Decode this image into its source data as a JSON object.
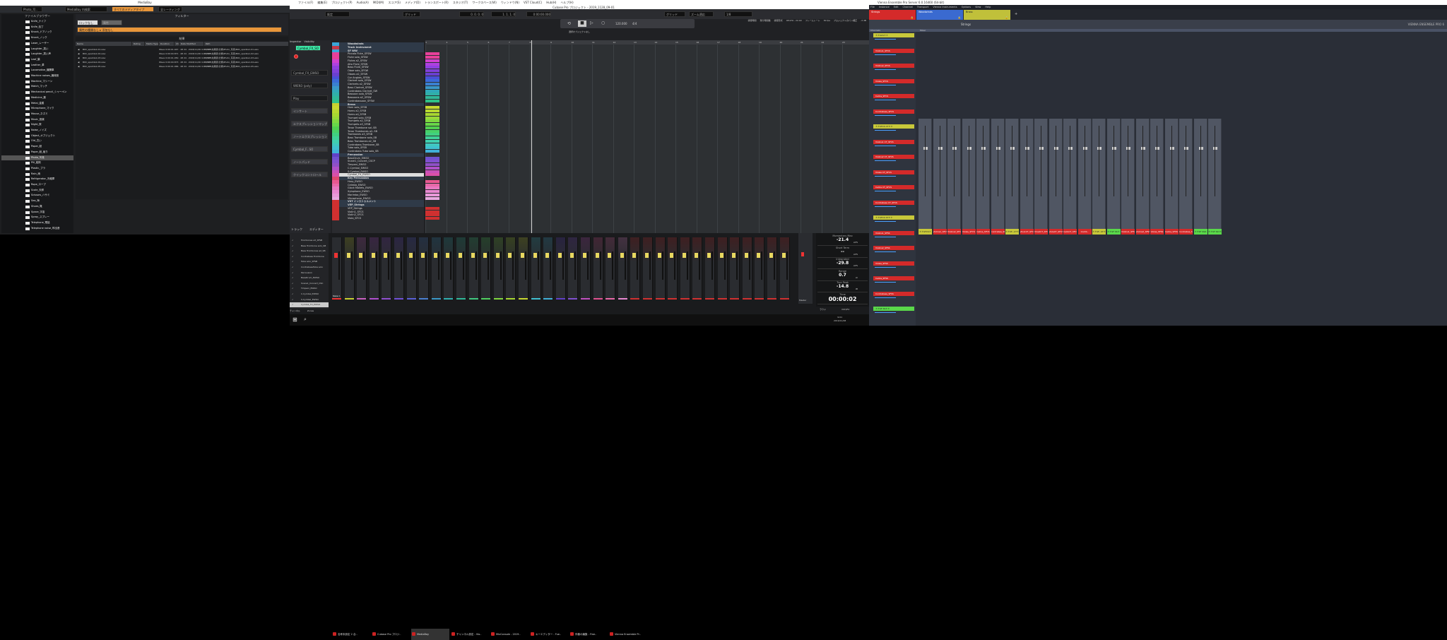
{
  "mediabay": {
    "title": "MediaBay",
    "path": "Photo_写..",
    "search_placeholder": "MediaBay 内検索",
    "media_type": "すべてのメディアタイプ",
    "rating": "全レーティング",
    "browser_header": "ファイルブラウザー",
    "filter_header": "フィルター",
    "filter_btn1": "ロックなし",
    "filter_btn2": "属性",
    "filter_tag1": "属性の種類なし",
    "filter_tag2": "添加なし",
    "results_header": "結果",
    "columns": [
      "Name",
      "Rating",
      "Media Type",
      "Duration",
      "Ch",
      "Date Modified",
      "Path"
    ],
    "results": [
      {
        "name": "B0C_sparkle1-01.wav",
        "info": "Wave 0:00:01.047 · 48 24 · 2018/11/26 11:17:07",
        "path": "E:\\SFX\\効果音\\分類\\Photo_写真\\B0C_sparkle1-01.wav"
      },
      {
        "name": "B0C_sparkle1-02.wav",
        "info": "Wave 0:00:00.871 · 48 24 · 2018/11/26 11:17:07",
        "path": "E:\\SFX\\効果音\\分類\\Photo_写真\\B0C_sparkle1-02.wav"
      },
      {
        "name": "B0C_sparkle1-03.wav",
        "info": "Wave 0:00:01.050 · 48 24 · 2018/11/26 11:17:07",
        "path": "E:\\SFX\\効果音\\分類\\Photo_写真\\B0C_sparkle1-03.wav"
      },
      {
        "name": "B0C_sparkle1-04.wav",
        "info": "Wave 0:00:00.873 · 48 24 · 2018/11/26 11:17:07",
        "path": "E:\\SFX\\効果音\\分類\\Photo_写真\\B0C_sparkle1-04.wav"
      },
      {
        "name": "B0C_sparkle1-05.wav",
        "info": "Wave 0:00:01.066 · 48 24 · 2018/11/26 11:17:07",
        "path": "E:\\SFX\\効果音\\分類\\Photo_写真\\B0C_sparkle1-05.wav"
      }
    ],
    "folders": [
      "Knife_ナイフ",
      "Knife_包丁",
      "Knock_ドアノック",
      "Knock_ノック",
      "Laser_レーザー",
      "Laughter_笑い",
      "Laughter_笑い声",
      "Leaf_葉",
      "Leather_革",
      "Locomotive_機関車",
      "Machine noises_機械音",
      "Machine_マシーン",
      "Match_マッチ",
      "Mechanical pencil_シャーペン",
      "Medicine_薬",
      "Metal_金属",
      "Microphone_マイク",
      "Mouse_ネズミ",
      "Music_音楽",
      "Night_夜",
      "Noise_ノイズ",
      "Object_オブジェクト",
      "Old_古い",
      "Paper_紙",
      "Paper_紙_破り",
      "Photo_写真",
      "Pill_錠剤",
      "Plastic_プラ",
      "Rain_雨",
      "Refrigerator_冷蔵庫",
      "Rope_ロープ",
      "Scale_天秤",
      "Scissors_ハサミ",
      "Sea_海",
      "Shoes_靴",
      "Space_宇宙",
      "Spray_スプレー",
      "Telephone_電話",
      "Telephone noise_呼出音"
    ]
  },
  "cubase": {
    "menu": [
      "ファイル(F)",
      "編集(E)",
      "プロジェクト(P)",
      "Audio(A)",
      "MIDI(M)",
      "スコア(S)",
      "メディア(D)",
      "トランスポート(R)",
      "スタジオ(T)",
      "ワークスペース(W)",
      "ウィンドウ(N)",
      "VST Cloud(C)",
      "Hub(H)",
      "ヘルプ(H)"
    ],
    "title": "Cubase Pro プロジェクト - 2019_1128_09-01",
    "app_title": "Cubase Pro",
    "mode": "既定",
    "grid": "グリッド",
    "zoom": "ズーム適応",
    "quantize": "1/8",
    "snap": "グリッド",
    "pos1": "0. 0. 0. 0",
    "pos2": "1. 1. 1. 0",
    "time": "0:00:00.000",
    "tempo": "120.000",
    "signature": "4/4",
    "status": [
      "録音時間",
      "残り時間数",
      "録音形式",
      "48 kHz - 24 bit",
      "フレームレート",
      "30 fps",
      "プロジェクトのパン補正",
      "-3 dB"
    ],
    "marker_label": "選択オブジェクトなし",
    "inspector_tabs": [
      "Inspector",
      "Visibility"
    ],
    "inspector_track": "Cymbal_FX_SO",
    "inspector_sections": [
      "Cymbal_FX_EWSO",
      "WIEN3 (poly)",
      "Play",
      "インサート",
      "エクスプレッションマップ",
      "ノートエクスプレッション",
      "Cymbal_F...SO",
      "ノートパッド",
      "クイックコントロール"
    ],
    "lower_tabs": [
      "トラック",
      "エディター"
    ],
    "ruler": [
      "3",
      "4",
      "5",
      "6",
      "7",
      "8",
      "9",
      "10",
      "11",
      "12",
      "13",
      "14",
      "15",
      "16",
      "17",
      "18",
      "19",
      "20",
      "21",
      "22",
      "23"
    ],
    "tracks": [
      {
        "n": "Woodwinds",
        "c": "#3aa6d8",
        "f": 1
      },
      {
        "n": "Track Instrument",
        "c": "#c23a4a",
        "f": 1
      },
      {
        "n": "SF WW",
        "c": "#3aa6d8",
        "f": 1
      },
      {
        "n": "Piccolo Flute_SFSW",
        "c": "#e8409a"
      },
      {
        "n": "Flute solo_SFSW",
        "c": "#e8409a"
      },
      {
        "n": "Flutes a2_SFSW",
        "c": "#d040d0"
      },
      {
        "n": "Alto Flute_SFSW",
        "c": "#b040e0"
      },
      {
        "n": "Bass Flute_SFSW",
        "c": "#9040e0"
      },
      {
        "n": "Oboe solo_SFSW",
        "c": "#8040d8"
      },
      {
        "n": "Oboes a2_SFSW",
        "c": "#6a40d0"
      },
      {
        "n": "Cor Anglais_SFSW",
        "c": "#4a50d8"
      },
      {
        "n": "Clarinet solo_SFSW",
        "c": "#3a6ad8"
      },
      {
        "n": "Clarinets a2_SFSW",
        "c": "#3a80d0"
      },
      {
        "n": "Bass Clarinet_SFSW",
        "c": "#3a98c8"
      },
      {
        "n": "Contrabass Clarinet_SW",
        "c": "#30a8b8"
      },
      {
        "n": "Bassoon solo_SFSW",
        "c": "#30b0a8"
      },
      {
        "n": "Bassoons a2_SFSW",
        "c": "#30b898"
      },
      {
        "n": "Contrabassoon_SFSW",
        "c": "#30c088"
      },
      {
        "n": "Brass",
        "c": "#c8d030",
        "f": 1
      },
      {
        "n": "Horn solo_SFSB",
        "c": "#c8d830"
      },
      {
        "n": "Horns a2_SFSB",
        "c": "#b8d830"
      },
      {
        "n": "Horns a4_SFSB",
        "c": "#a8d830"
      },
      {
        "n": "Trumpet solo_SFSB",
        "c": "#98d838"
      },
      {
        "n": "Trumpets a2_SFSB",
        "c": "#80d840"
      },
      {
        "n": "Trumpets a3_SFSB",
        "c": "#68d848"
      },
      {
        "n": "Tenor Trombone sol..SB",
        "c": "#50d050"
      },
      {
        "n": "Tenor Trombones a2..SB",
        "c": "#48d068"
      },
      {
        "n": "Trombones a3_SFSB",
        "c": "#40d080"
      },
      {
        "n": "Bass Trombone solo_SB",
        "c": "#40d098"
      },
      {
        "n": "Bass Trombones a2_SB",
        "c": "#40d0b0"
      },
      {
        "n": "Contrabass Trombone_SB",
        "c": "#40c8c0"
      },
      {
        "n": "Tuba solo_SFSB",
        "c": "#40c0d0"
      },
      {
        "n": "Contrabass Tuba solo_SB",
        "c": "#40b0d8"
      },
      {
        "n": "Percussion",
        "c": "#6040c8",
        "f": 1
      },
      {
        "n": "BassDrum_EWSO",
        "c": "#7050d0"
      },
      {
        "n": "Snare1_Concert_CSCP",
        "c": "#8050d0"
      },
      {
        "n": "Timpani_EWSO",
        "c": "#9050c8"
      },
      {
        "n": "C.Cymbal_EWSO",
        "c": "#b050c8"
      },
      {
        "n": "S.Cymbal_EWSO",
        "c": "#c850b8"
      },
      {
        "n": "Cymbal_FX_EWSO",
        "c": "#d850a8",
        "sel": 1
      },
      {
        "n": "Key Percussion",
        "c": "#e04870",
        "f": 1
      },
      {
        "n": "Harp_EWSO",
        "c": "#e85890"
      },
      {
        "n": "Celesta_EWSO",
        "c": "#e868a8"
      },
      {
        "n": "Glock Mallets_EWSO",
        "c": "#e878c0"
      },
      {
        "n": "Xylophone_EWSO",
        "c": "#e888d0"
      },
      {
        "n": "Marimba_EWSO",
        "c": "#e898d8"
      },
      {
        "n": "Vibraphone_EWSO",
        "c": "#e8a8e0"
      },
      {
        "n": "VST インストゥルメント",
        "c": "#d03030",
        "f": 1
      },
      {
        "n": "VEP_Strings",
        "c": "#d03030",
        "f": 1
      },
      {
        "n": "VEP_Strings",
        "c": "#d03030"
      },
      {
        "n": "Violin1_SFCS",
        "c": "#d03030"
      },
      {
        "n": "Violin2_SFCS",
        "c": "#d03030"
      },
      {
        "n": "Viola_SFCS",
        "c": "#d03030"
      }
    ],
    "visibility_list": [
      "Trombones a3_SFSB",
      "Bass Trombone solo_SB",
      "Bass Trombones a2_SB",
      "Contrabass Trombone",
      "Tuba solo_SFSB",
      "ContrabassTuba solo",
      "Percussion",
      "BassDrum_EWSO",
      "Snare1_Concert_CSC",
      "Timpani_EWSO",
      "C.Cymbal_EWSO",
      "S.Cymbal_EWSO",
      "Cymbal_FX_EWSO"
    ],
    "mixer_tabs": [
      "チャンネル",
      "Zones"
    ],
    "master_label": "Master",
    "first_channel": "Stereo 1",
    "loudness": {
      "momentary_label": "Momentary Max",
      "momentary": "-21.4",
      "short_label": "Short Term",
      "short": "--",
      "integrated_label": "Integrated",
      "integrated": "-29.8",
      "range_label": "Range",
      "range": "0.7",
      "truepeak_label": "True Peak",
      "truepeak": "-14.8",
      "time_label": "Time",
      "time": "00:00:02",
      "lufs": "LUFS",
      "lu": "LU",
      "db": "dB",
      "tabs": [
        "ラウド",
        "VSTi/FX"
      ]
    }
  },
  "taskbar": {
    "items": [
      "名称未設定 2 合..",
      "Cubase Pro プロジ..",
      "MediaBay",
      "チャンネル設定 - Vio..",
      "MixConsole - 2019..",
      "キーエディター - Fue..",
      "伴奏の編集 - Fine..",
      "Vienna Ensemble Pr.."
    ],
    "clock_time": "9:01",
    "clock_date": "2019/11/28"
  },
  "vep": {
    "title": "Vienna Ensemble Pro Server 6.0.16460 (64-bit)",
    "menu": [
      "File",
      "Instance",
      "Edit",
      "Channel",
      "Transport",
      "Vienna Instruments",
      "Options",
      "View",
      "Help"
    ],
    "instances": [
      {
        "name": "Strings",
        "color": "#d42a2a"
      },
      {
        "name": "Woodwinds",
        "color": "#3a6ad0"
      },
      {
        "name": "Brass",
        "color": "#c0c03a"
      }
    ],
    "add_tab": "+",
    "current": "Strings",
    "panel_channels": "Channels",
    "panel_mixer": "Mixer",
    "brand": "VIENNA ENSEMBLE PRO 6",
    "channel_list": [
      {
        "n": "＊＊SCS＊＊",
        "c": "#c8c83a"
      },
      {
        "n": "Violins1_SFCS",
        "c": "#d42a2a"
      },
      {
        "n": "Violins2_SFCS",
        "c": "#d42a2a"
      },
      {
        "n": "Violas_SFCS",
        "c": "#d42a2a"
      },
      {
        "n": "Cellos_SFCS",
        "c": "#d42a2a"
      },
      {
        "n": "Contrabass_SFCS",
        "c": "#d42a2a"
      },
      {
        "n": "＊＊SFCS CT＊＊",
        "c": "#c8c83a"
      },
      {
        "n": "Violins1 CT_SFCS",
        "c": "#d42a2a"
      },
      {
        "n": "Violins2 CT_SFCS",
        "c": "#d42a2a"
      },
      {
        "n": "Violas CT_SFCS",
        "c": "#d42a2a"
      },
      {
        "n": "Cellos CT_SFCS",
        "c": "#d42a2a"
      },
      {
        "n": "Contrabass CT_SFCS",
        "c": "#d42a2a"
      },
      {
        "n": "＊＊SFCS ST＊＊",
        "c": "#c8c83a"
      },
      {
        "n": "Violins1_SFSS",
        "c": "#d42a2a"
      },
      {
        "n": "Violins2_SFSS",
        "c": "#d42a2a"
      },
      {
        "n": "Violas_SFSS",
        "c": "#d42a2a"
      },
      {
        "n": "Cellos_SFSS",
        "c": "#d42a2a"
      },
      {
        "n": "Contrabass_SFSS",
        "c": "#d42a2a"
      },
      {
        "n": "＊＊SF SS＊＊",
        "c": "#5ad84a"
      }
    ],
    "mixer_labels": [
      {
        "n": "＊＊SFCS＊＊",
        "c": "#c8c83a"
      },
      {
        "n": "Violins1_SFCS",
        "c": "#d42a2a"
      },
      {
        "n": "Violins2_SFCS",
        "c": "#d42a2a"
      },
      {
        "n": "Violas_SFCS",
        "c": "#d42a2a"
      },
      {
        "n": "Cellos_SFCS",
        "c": "#d42a2a"
      },
      {
        "n": "Contrabas_SFCS",
        "c": "#d42a2a"
      },
      {
        "n": "＊＊SF...CT＊＊",
        "c": "#c8c83a"
      },
      {
        "n": "Vlns1CT_SFCS",
        "c": "#d42a2a"
      },
      {
        "n": "Vlns2CT_SFCS",
        "c": "#d42a2a"
      },
      {
        "n": "ViolaCT_SFCS",
        "c": "#d42a2a"
      },
      {
        "n": "CelloCT_SFCS",
        "c": "#d42a2a"
      },
      {
        "n": "Contb..",
        "c": "#d42a2a"
      },
      {
        "n": "＊＊SF...ST＊＊",
        "c": "#c8c83a"
      },
      {
        "n": "＊＊SF SS＊＊",
        "c": "#5ad84a"
      },
      {
        "n": "Violins1_SFSS",
        "c": "#d42a2a"
      },
      {
        "n": "Violins2_SFSS",
        "c": "#d42a2a"
      },
      {
        "n": "Violas_SFSS",
        "c": "#d42a2a"
      },
      {
        "n": "Cellos_SFSS",
        "c": "#d42a2a"
      },
      {
        "n": "Contrabas_SFSS",
        "c": "#d42a2a"
      },
      {
        "n": "＊＊SF SSO＊＊",
        "c": "#5ad84a"
      },
      {
        "n": "＊＊SF SS?＊＊",
        "c": "#5ad84a"
      }
    ]
  }
}
